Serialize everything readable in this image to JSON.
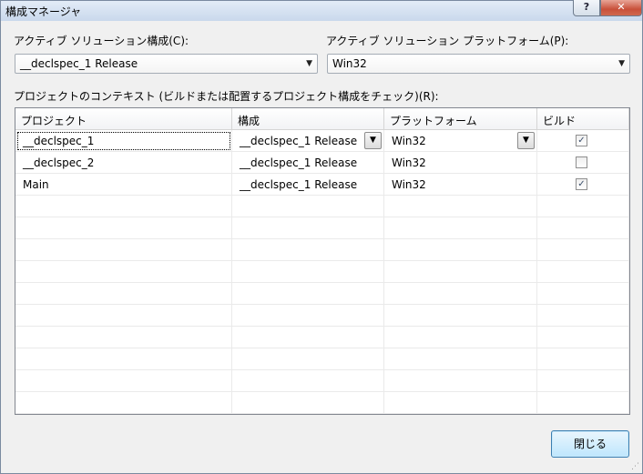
{
  "window": {
    "title": "構成マネージャ",
    "help_glyph": "?",
    "close_glyph": "✕"
  },
  "active_config": {
    "label": "アクティブ ソリューション構成(C):",
    "value": "__declspec_1 Release"
  },
  "active_platform": {
    "label": "アクティブ ソリューション プラットフォーム(P):",
    "value": "Win32"
  },
  "context_label": "プロジェクトのコンテキスト (ビルドまたは配置するプロジェクト構成をチェック)(R):",
  "table": {
    "headers": [
      "プロジェクト",
      "構成",
      "プラットフォーム",
      "ビルド"
    ],
    "rows": [
      {
        "project": "__declspec_1",
        "config": "__declspec_1 Release",
        "platform": "Win32",
        "build": true
      },
      {
        "project": "__declspec_2",
        "config": "__declspec_1 Release",
        "platform": "Win32",
        "build": false
      },
      {
        "project": "Main",
        "config": "__declspec_1 Release",
        "platform": "Win32",
        "build": true
      }
    ]
  },
  "close_button": "閉じる",
  "icons": {
    "dropdown": "chevron-down-icon",
    "check": "checkmark-icon"
  },
  "colors": {
    "titlebar": "#c9d8ec",
    "close_button": "#c8503a",
    "default_button": "#bee6fd"
  }
}
